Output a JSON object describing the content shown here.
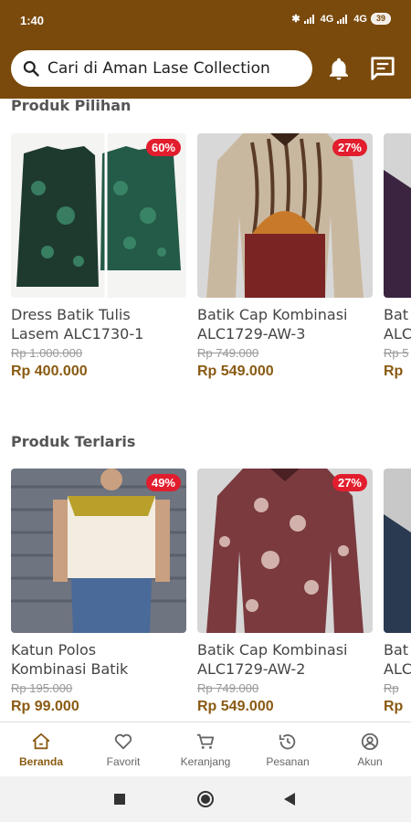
{
  "status": {
    "time": "1:40",
    "net1": "4G",
    "net2": "4G",
    "battery": "39"
  },
  "search": {
    "placeholder": "Cari di Aman Lase Collection"
  },
  "sections": [
    {
      "title": "Produk Pilihan",
      "products": [
        {
          "name": "Dress Batik Tulis\nLasem ALC1730-1",
          "old_price": "Rp 1.000.000",
          "price": "Rp 400.000",
          "discount": "60%"
        },
        {
          "name": "Batik Cap Kombinasi\nALC1729-AW-3",
          "old_price": "Rp 749.000",
          "price": "Rp 549.000",
          "discount": "27%"
        },
        {
          "name": "Bat\nALC",
          "old_price": "Rp 5",
          "price": "Rp",
          "discount": ""
        }
      ]
    },
    {
      "title": "Produk Terlaris",
      "products": [
        {
          "name": "Katun Polos\nKombinasi Batik",
          "old_price": "Rp 195.000",
          "price": "Rp 99.000",
          "discount": "49%"
        },
        {
          "name": "Batik Cap Kombinasi\nALC1729-AW-2",
          "old_price": "Rp 749.000",
          "price": "Rp 549.000",
          "discount": "27%"
        },
        {
          "name": "Bat\nALC",
          "old_price": "Rp",
          "price": "Rp",
          "discount": ""
        }
      ]
    }
  ],
  "nav": [
    {
      "label": "Beranda",
      "icon": "home-icon",
      "active": true
    },
    {
      "label": "Favorit",
      "icon": "heart-icon",
      "active": false
    },
    {
      "label": "Keranjang",
      "icon": "cart-icon",
      "active": false
    },
    {
      "label": "Pesanan",
      "icon": "history-icon",
      "active": false
    },
    {
      "label": "Akun",
      "icon": "account-icon",
      "active": false
    }
  ],
  "colors": {
    "brand": "#7a4a0d",
    "price": "#8a5a12",
    "badge": "#e21d2d"
  }
}
